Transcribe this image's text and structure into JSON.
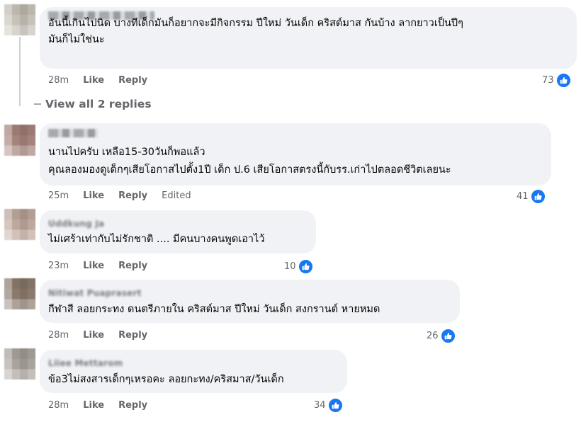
{
  "comments": [
    {
      "name": "",
      "text_lines": [
        "อันนี้เกินไปนิด บางทีเด็กมันก็อยากจะมีกิจกรรม ปีใหม่ วันเด็ก คริสต์มาส กันบ้าง ลากยาวเป็นปีๆ",
        "มันก็ไม่ใช่นะ"
      ],
      "time": "28m",
      "like": "Like",
      "reply": "Reply",
      "edited": "",
      "reactions": "73",
      "avatar_color": "#c7c2b8"
    },
    {
      "name": "",
      "text_lines": [
        "นานไปครับ เหลือ15-30วันก็พอแล้ว",
        "คุณลองมองดูเด็กๆเสียโอกาสไปตั้ง1ปี เด็ก ป.6 เสียโอกาสตรงนี้กับรร.เก่าไปตลอดชีวิตเลยนะ"
      ],
      "time": "25m",
      "like": "Like",
      "reply": "Reply",
      "edited": "Edited",
      "reactions": "41",
      "avatar_color": "#a5827a"
    },
    {
      "name": "Uddkung Ja",
      "text_lines": [
        "ไม่เศร้าเท่ากับไม่รักชาติ .... มีคนบางคนพูดเอาไว้"
      ],
      "time": "23m",
      "like": "Like",
      "reply": "Reply",
      "edited": "",
      "reactions": "10",
      "avatar_color": "#bfa79b"
    },
    {
      "name": "Nitiwat Puaprasert",
      "text_lines": [
        "กีฬาสี ลอยกระทง ดนตรีภายใน คริสต์มาส ปีใหม่ วันเด็ก สงกรานต์ หายหมด"
      ],
      "time": "28m",
      "like": "Like",
      "reply": "Reply",
      "edited": "",
      "reactions": "26",
      "avatar_color": "#8b7a6c"
    },
    {
      "name": "Liiee Mettarom",
      "text_lines": [
        "ข้อ3ไม่สงสารเด็กๆเหรอคะ ลอยกะทง/คริสมาส/วันเด็ก"
      ],
      "time": "28m",
      "like": "Like",
      "reply": "Reply",
      "edited": "",
      "reactions": "34",
      "avatar_color": "#a9a39c"
    }
  ],
  "view_replies": "View all 2 replies",
  "icons": {
    "reaction": "like-thumb-icon"
  },
  "colors": {
    "accent": "#1877f2",
    "bubble": "#f0f2f5",
    "meta": "#65676b"
  }
}
